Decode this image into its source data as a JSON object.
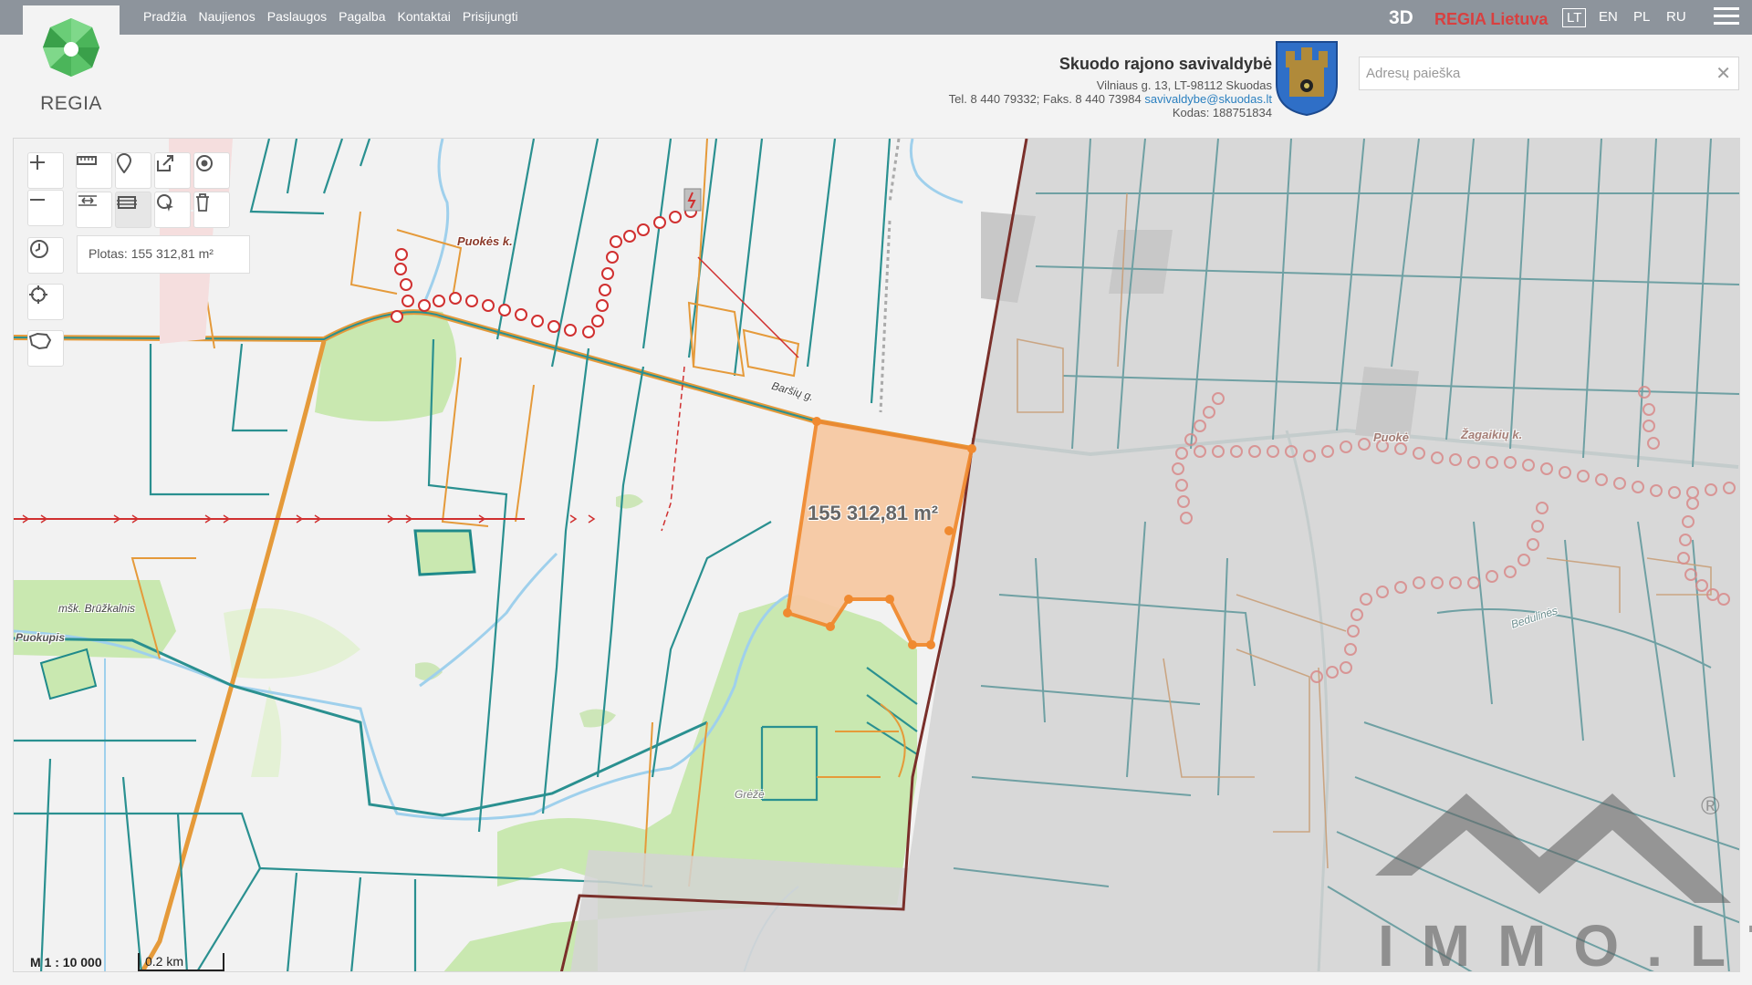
{
  "header": {
    "logo_text": "REGIA",
    "nav": [
      "Pradžia",
      "Naujienos",
      "Paslaugos",
      "Pagalba",
      "Kontaktai",
      "Prisijungti"
    ],
    "view_3d": "3D",
    "regia_lietuva": "REGIA Lietuva",
    "languages": [
      "LT",
      "EN",
      "PL",
      "RU"
    ],
    "active_language": "LT"
  },
  "municipality": {
    "title": "Skuodo rajono savivaldybė",
    "address": "Vilniaus g. 13, LT-98112 Skuodas",
    "phone_fax": "Tel. 8 440 79332; Faks. 8 440 73984",
    "email": "savivaldybe@skuodas.lt",
    "code": "Kodas: 188751834"
  },
  "search": {
    "placeholder": "Adresų paieška",
    "value": "",
    "clear": "✕"
  },
  "map": {
    "area_info": "Plotas: 155 312,81 m²",
    "measure_label": "155 312,81 m²",
    "labels": {
      "village_1": "Puokės k.",
      "village_2": "Žagaikių k.",
      "village_3": "Puokė",
      "street": "Baršių g.",
      "forest": "mšk. Brūžkalnis",
      "stream": "Puokupis",
      "forest_2": "Grėžė",
      "road": "Bedulinės"
    },
    "scale": {
      "ratio": "M 1 : 10 000",
      "bar": "0.2 km"
    },
    "watermark": "IMMO.LT",
    "registered": "®"
  },
  "colors": {
    "cadastre": "#2a9090",
    "orange": "#f0a040",
    "forest": "#c9e8b0",
    "measure_fill": "#f7c9a3",
    "measure_stroke": "#f08a30",
    "gray_overlay": "#cfcfcf"
  }
}
